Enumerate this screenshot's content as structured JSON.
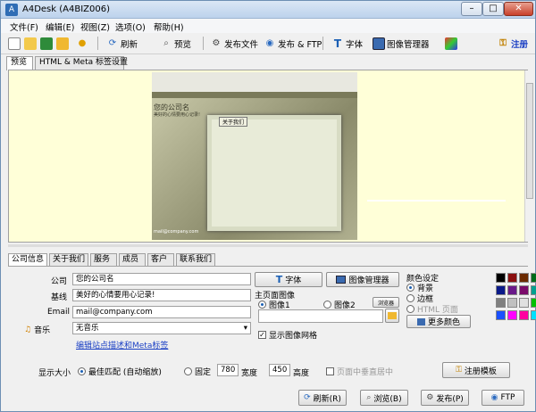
{
  "window": {
    "title": "A4Desk (A4BIZ006)"
  },
  "menu": [
    "文件(F)",
    "编辑(E)",
    "视图(Z)",
    "选项(O)",
    "帮助(H)"
  ],
  "toolbar": {
    "refresh": "刷新",
    "preview": "预览",
    "publish_file": "发布文件",
    "publish_ftp": "发布 & FTP",
    "font": "字体",
    "image_manager": "图像管理器",
    "register": "注册"
  },
  "top_tabs": [
    "预览",
    "HTML & Meta 标签设置"
  ],
  "bottom_tabs": [
    "公司信息",
    "关于我们",
    "服务",
    "成员",
    "客户",
    "联系我们"
  ],
  "preview_site": {
    "logo": "您的公司名",
    "slogan": "美好的心情要用心记录!",
    "frame_label": "关于我们",
    "email": "mail@company.com"
  },
  "form": {
    "company_label": "公司",
    "company_value": "您的公司名",
    "slogan_label": "基线",
    "slogan_value": "美好的心情要用心记录!",
    "email_label": "Email",
    "email_value": "mail@company.com",
    "music_label": "音乐",
    "music_value": "无音乐",
    "seo_link": "编辑站点描述和Meta标签",
    "font_button": "字体",
    "image_manager_button": "图像管理器",
    "main_image_label": "主页面图像",
    "image1": "图像1",
    "image2": "图像2",
    "browse": "浏览器",
    "show_grid": "显示图像网格",
    "color_label": "颜色设定",
    "color_bg": "背景",
    "color_border": "边框",
    "color_html": "HTML 页面",
    "more_colors": "更多颜色",
    "display_size_label": "显示大小",
    "fit_best": "最佳匹配 (自动缩放)",
    "fixed": "固定",
    "width_value": "780",
    "width_label": "宽度",
    "height_value": "450",
    "height_label": "高度",
    "center_vertical": "页面中垂直居中",
    "register_template": "注册模板"
  },
  "footer": {
    "refresh": "刷新(R)",
    "preview": "浏览(B)",
    "publish": "发布(P)",
    "ftp": "FTP"
  },
  "swatches": [
    "#000000",
    "#8b1010",
    "#6b2a00",
    "#006b1a",
    "#0a1a8a",
    "#6a1a8a",
    "#7a0a6a",
    "#00a090",
    "#808080",
    "#c0c0c0",
    "#e0e0e0",
    "#00c000",
    "#1a50ff",
    "#ff00ff",
    "#ff00a0",
    "#00e0ff"
  ]
}
